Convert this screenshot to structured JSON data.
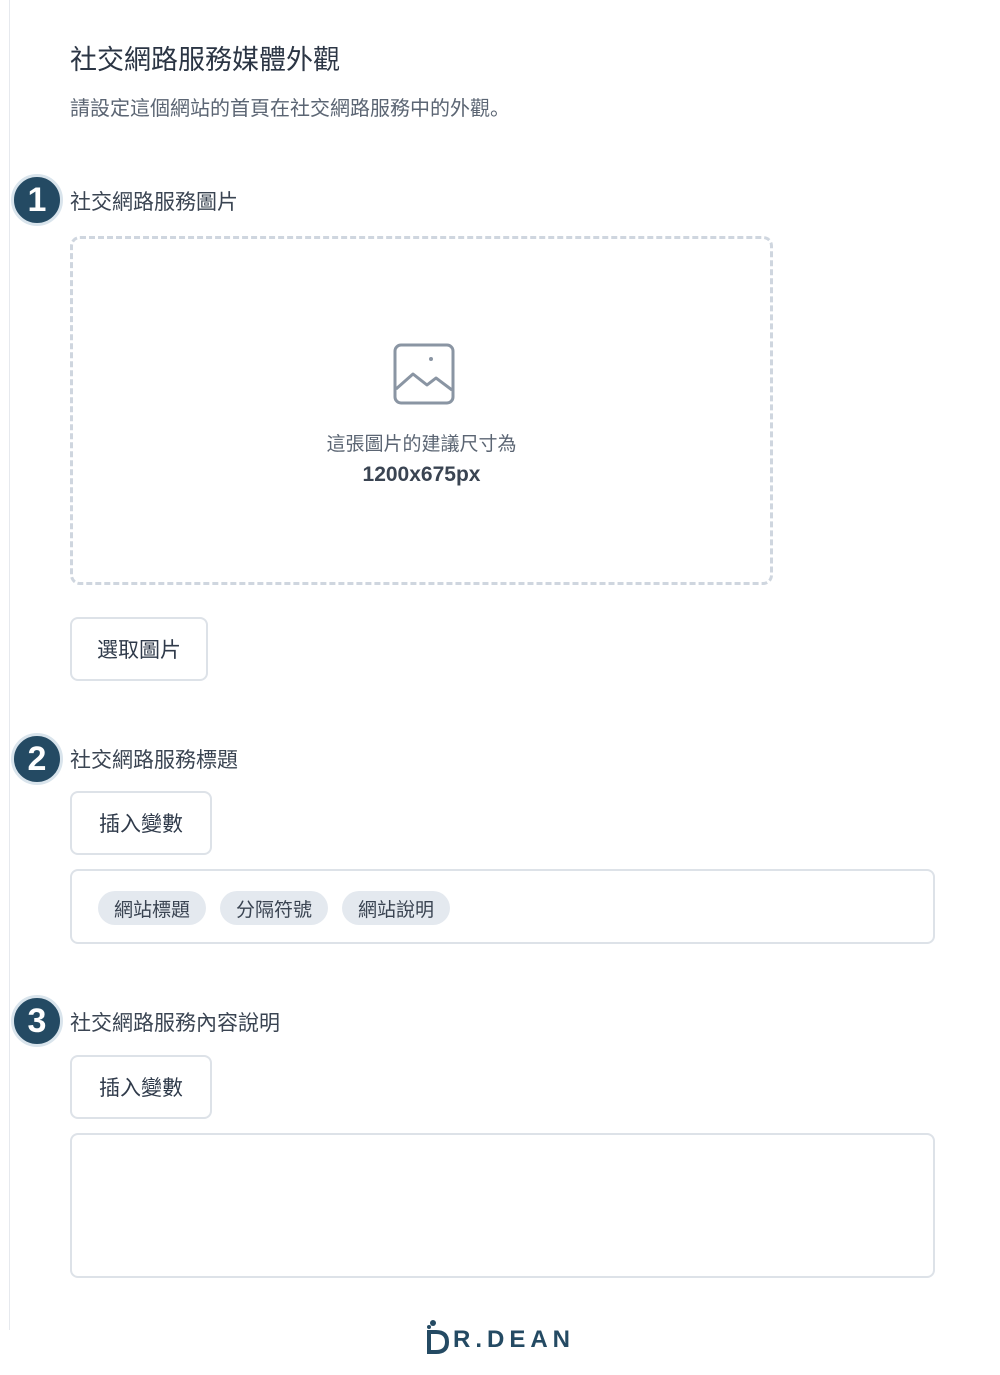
{
  "header": {
    "title": "社交網路服務媒體外觀",
    "description": "請設定這個網站的首頁在社交網路服務中的外觀。"
  },
  "sections": [
    {
      "number": "1",
      "label": "社交網路服務圖片",
      "dropzone": {
        "hint": "這張圖片的建議尺寸為",
        "size": "1200x675px"
      },
      "button": "選取圖片"
    },
    {
      "number": "2",
      "label": "社交網路服務標題",
      "button": "插入變數",
      "chips": [
        "網站標題",
        "分隔符號",
        "網站說明"
      ]
    },
    {
      "number": "3",
      "label": "社交網路服務內容說明",
      "button": "插入變數"
    }
  ],
  "brand": {
    "name": "R.DEAN",
    "color": "#244a63"
  },
  "colors": {
    "badge": "#244a63",
    "chip_bg": "#e4e9ef",
    "border": "#dde2e8"
  },
  "icons": [
    "image-icon"
  ]
}
